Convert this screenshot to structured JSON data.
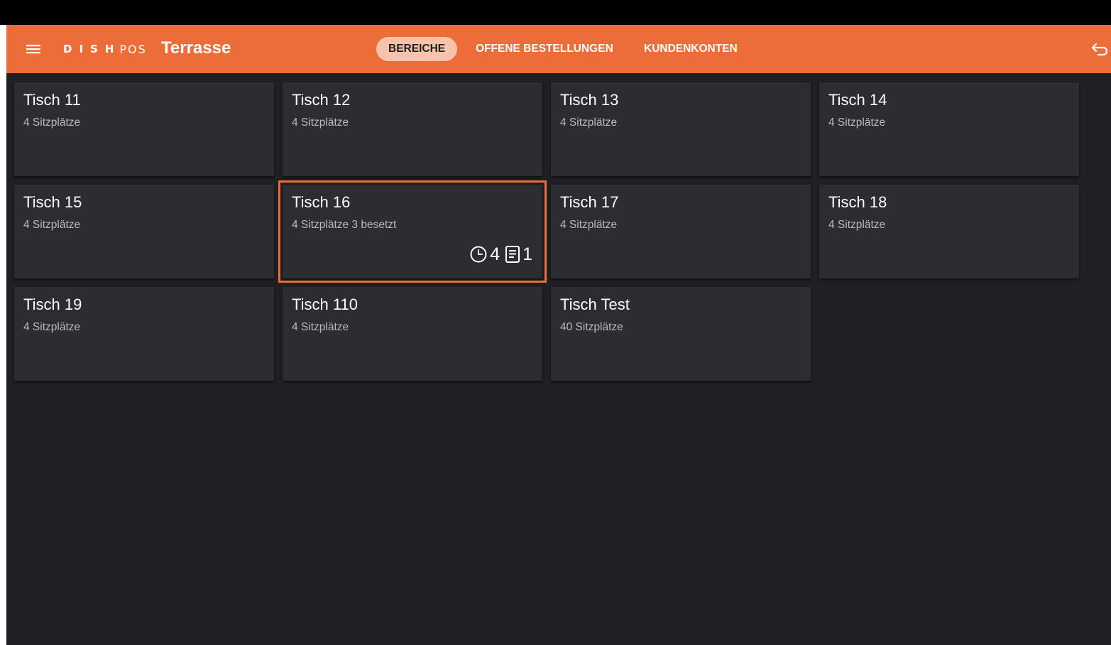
{
  "header": {
    "logo": {
      "dish": "DISH",
      "pos": "POS"
    },
    "area_title": "Terrasse",
    "tabs": [
      {
        "label": "BEREICHE",
        "active": true
      },
      {
        "label": "OFFENE BESTELLUNGEN",
        "active": false
      },
      {
        "label": "KUNDENKONTEN",
        "active": false
      }
    ],
    "icons": {
      "menu": "menu-icon",
      "back": "back-arrow-icon"
    }
  },
  "colors": {
    "accent": "#ec6d3a",
    "active_tab_bg": "#f7c3ad",
    "background": "#1f2023",
    "card": "#2c2d31"
  },
  "tables": [
    {
      "name": "Tisch 11",
      "seats": "4 Sitzplätze"
    },
    {
      "name": "Tisch 12",
      "seats": "4 Sitzplätze"
    },
    {
      "name": "Tisch 13",
      "seats": "4 Sitzplätze"
    },
    {
      "name": "Tisch 14",
      "seats": "4 Sitzplätze"
    },
    {
      "name": "Tisch 15",
      "seats": "4 Sitzplätze"
    },
    {
      "name": "Tisch 16",
      "seats": "4 Sitzplätze 3 besetzt",
      "selected": true,
      "status": {
        "clock_icon": "clock-icon",
        "clock_count": "4",
        "receipt_icon": "receipt-icon",
        "receipt_count": "1"
      }
    },
    {
      "name": "Tisch 17",
      "seats": "4 Sitzplätze"
    },
    {
      "name": "Tisch 18",
      "seats": "4 Sitzplätze"
    },
    {
      "name": "Tisch 19",
      "seats": "4 Sitzplätze"
    },
    {
      "name": "Tisch 110",
      "seats": "4 Sitzplätze"
    },
    {
      "name": "Tisch Test",
      "seats": "40 Sitzplätze"
    }
  ]
}
